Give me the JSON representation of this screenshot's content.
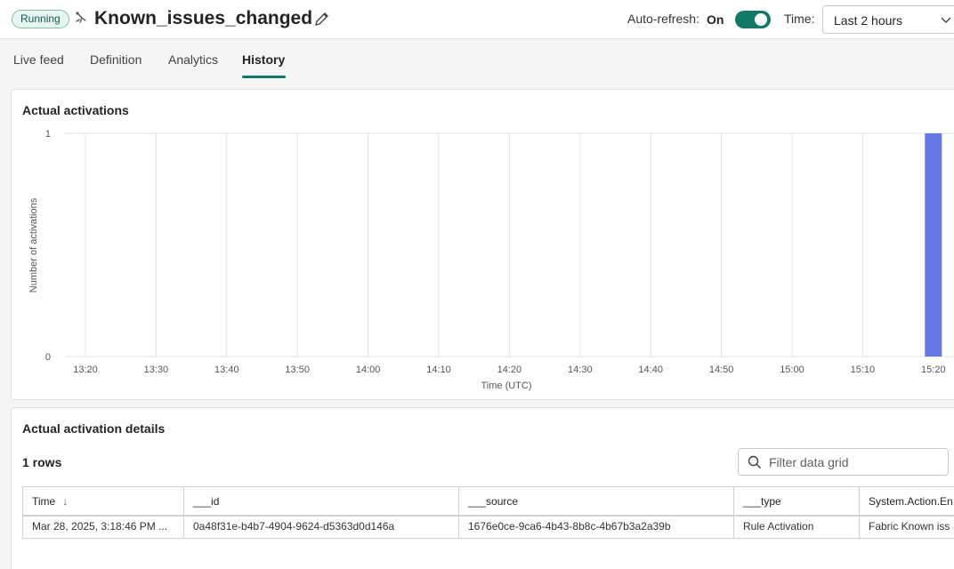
{
  "header": {
    "status": "Running",
    "title": "Known_issues_changed",
    "autorefresh_label": "Auto-refresh:",
    "autorefresh_value": "On",
    "time_label": "Time:",
    "time_value": "Last 2 hours"
  },
  "tabs": [
    {
      "label": "Live feed"
    },
    {
      "label": "Definition"
    },
    {
      "label": "Analytics"
    },
    {
      "label": "History",
      "active": true
    }
  ],
  "activations": {
    "title": "Actual activations"
  },
  "chart_data": {
    "type": "bar",
    "title": "Actual activations",
    "xlabel": "Time (UTC)",
    "ylabel": "Number of activations",
    "x_ticks": [
      "13:20",
      "13:30",
      "13:40",
      "13:50",
      "14:00",
      "14:10",
      "14:20",
      "14:30",
      "14:40",
      "14:50",
      "15:00",
      "15:10",
      "15:20"
    ],
    "y_ticks": [
      "0",
      "1"
    ],
    "ylim": [
      0,
      1
    ],
    "bars": [
      {
        "x": "15:20",
        "value": 1
      }
    ],
    "bar_color": "#6478e6",
    "grid": true
  },
  "details": {
    "title": "Actual activation details",
    "rows_count": "1 rows",
    "filter_placeholder": "Filter data grid",
    "columns": [
      "Time",
      "___id",
      "___source",
      "___type",
      "System.Action.En"
    ],
    "rows": [
      [
        "Mar 28, 2025, 3:18:46 PM ...",
        "0a48f31e-b4b7-4904-9624-d5363d0d146a",
        "1676e0ce-9ca6-4b43-8b8c-4b67b3a2a39b",
        "Rule Activation",
        "Fabric Known iss"
      ]
    ]
  },
  "colors": {
    "accent": "#117865",
    "bar": "#6478e6"
  }
}
